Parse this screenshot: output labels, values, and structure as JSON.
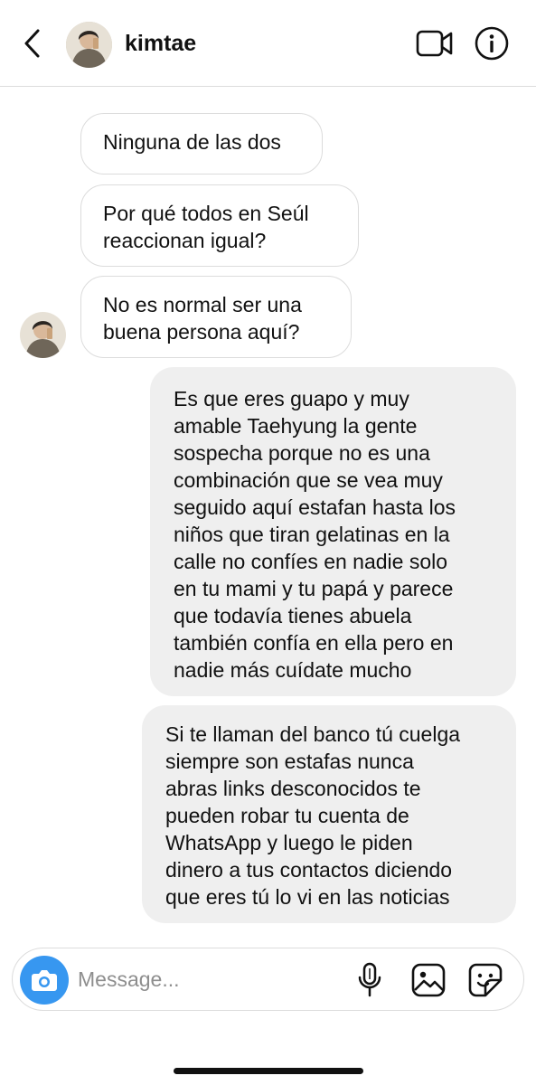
{
  "header": {
    "username": "kimtae",
    "icons": {
      "back": "chevron-left-icon",
      "video": "video-camera-icon",
      "info": "info-icon"
    }
  },
  "messages": [
    {
      "sender": "them",
      "text": "Ninguna de las dos"
    },
    {
      "sender": "them",
      "text": "Por qué todos en Seúl\nreaccionan igual?"
    },
    {
      "sender": "them",
      "text": "No es normal ser una\nbuena persona aquí?"
    },
    {
      "sender": "me",
      "text": "Es que eres guapo y muy\namable Taehyung la gente\nsospecha porque no es una\ncombinación que se vea muy\nseguido aquí estafan hasta los\nniños que tiran gelatinas en la\ncalle no confíes en nadie solo\nen tu mami y tu papá y parece\nque todavía tienes abuela\ntambién confía en ella pero en\nnadie más cuídate mucho"
    },
    {
      "sender": "me",
      "text": "Si te llaman del banco tú cuelga\nsiempre son estafas nunca\nabras links desconocidos te\npueden robar tu cuenta de\nWhatsApp y luego le piden\ndinero a tus contactos diciendo\nque eres tú lo vi en las noticias"
    }
  ],
  "composer": {
    "placeholder": "Message...",
    "value": "",
    "icons": {
      "camera": "camera-icon",
      "mic": "microphone-icon",
      "gallery": "image-gallery-icon",
      "sticker": "sticker-icon"
    }
  },
  "colors": {
    "accent": "#3797f0",
    "incoming_border": "#dcdcdc",
    "outgoing_bg": "#efefef"
  }
}
